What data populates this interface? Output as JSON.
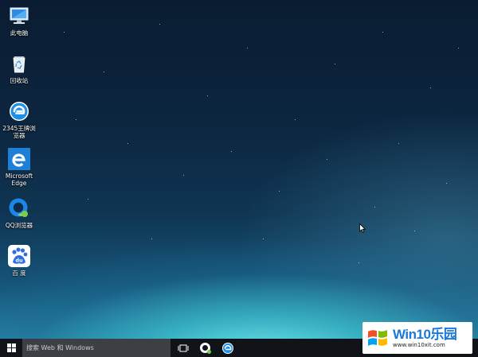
{
  "desktop": {
    "icons": [
      {
        "id": "this-pc",
        "label": "此电脑"
      },
      {
        "id": "recycle-bin",
        "label": "回收站"
      },
      {
        "id": "browser-2345",
        "label": "2345王牌浏\n览器"
      },
      {
        "id": "microsoft-edge",
        "label": "Microsoft\nEdge"
      },
      {
        "id": "qq-browser",
        "label": "QQ浏览器"
      },
      {
        "id": "baidu",
        "label": "百 度",
        "glyph_text": "du"
      }
    ]
  },
  "taskbar": {
    "search_placeholder": "搜索 Web 和 Windows",
    "pinned": [
      "task-view",
      "qq-browser",
      "2345-browser"
    ]
  },
  "watermark": {
    "title": "Win10乐园",
    "url": "www.win10xit.com"
  },
  "colors": {
    "taskbar": "#101318",
    "search_box": "#3c3f44",
    "accent_blue": "#1a78d8",
    "edge_blue": "#1e7fd6",
    "baidu_blue": "#2d6fe0"
  }
}
